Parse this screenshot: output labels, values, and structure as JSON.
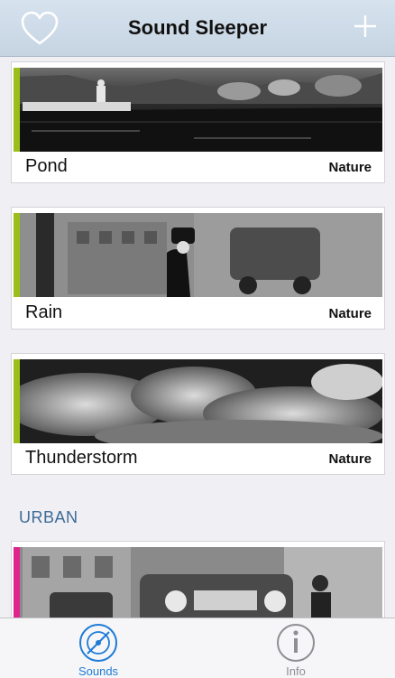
{
  "app": {
    "title": "Sound Sleeper"
  },
  "navbar": {
    "left_icon": "heart-icon",
    "right_icon": "plus-icon"
  },
  "sounds": [
    {
      "name": "Pond",
      "category": "Nature",
      "accent": "#9bbf1a"
    },
    {
      "name": "Rain",
      "category": "Nature",
      "accent": "#9bbf1a"
    },
    {
      "name": "Thunderstorm",
      "category": "Nature",
      "accent": "#9bbf1a"
    }
  ],
  "urban_section": {
    "header": "URBAN",
    "first_item": {
      "accent": "#e0248e"
    }
  },
  "tabbar": {
    "tabs": [
      {
        "label": "Sounds",
        "icon": "disc-icon",
        "selected": true,
        "color": "#1f7bd6"
      },
      {
        "label": "Info",
        "icon": "info-icon",
        "selected": false,
        "color": "#8e8e93"
      }
    ]
  }
}
